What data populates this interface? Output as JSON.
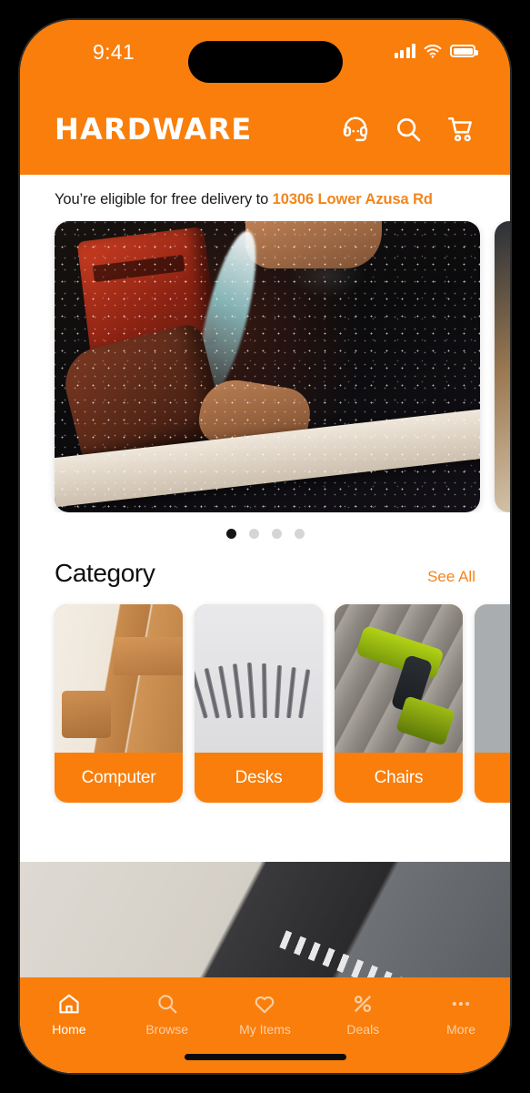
{
  "status_bar": {
    "time": "9:41",
    "icons": [
      "signal-bars-icon",
      "wifi-icon",
      "battery-icon"
    ]
  },
  "header": {
    "brand": "HARDWARE",
    "actions": [
      {
        "name": "support-headset-icon",
        "label": "Support"
      },
      {
        "name": "search-icon",
        "label": "Search"
      },
      {
        "name": "cart-icon",
        "label": "Cart"
      }
    ]
  },
  "delivery": {
    "message": "You’re eligible for free delivery to ",
    "address": "10306 Lower Azusa Rd"
  },
  "hero": {
    "slides": [
      {
        "alt": "Power tool cutting wood with sawdust spray"
      },
      {
        "alt": "Workshop lumber close-up"
      }
    ],
    "dots": 4,
    "active_dot": 0
  },
  "category": {
    "title": "Category",
    "see_all": "See All",
    "items": [
      {
        "label": "Computer",
        "thumb": "lumber-stack-image"
      },
      {
        "label": "Desks",
        "thumb": "screws-row-image"
      },
      {
        "label": "Chairs",
        "thumb": "cordless-drill-image"
      },
      {
        "label": "",
        "thumb": "gray-placeholder-image"
      }
    ]
  },
  "bottom_banner": {
    "alt": "Table saw cutting a wooden plank"
  },
  "bottom_nav": {
    "items": [
      {
        "label": "Home",
        "icon": "home-icon",
        "active": true
      },
      {
        "label": "Browse",
        "icon": "search-icon",
        "active": false
      },
      {
        "label": "My Items",
        "icon": "heart-icon",
        "active": false
      },
      {
        "label": "Deals",
        "icon": "percent-icon",
        "active": false
      },
      {
        "label": "More",
        "icon": "ellipsis-icon",
        "active": false
      }
    ]
  },
  "colors": {
    "brand_orange": "#f97e0c",
    "accent_link": "#f2851b",
    "text_dark": "#0f0f0f",
    "white": "#ffffff"
  }
}
